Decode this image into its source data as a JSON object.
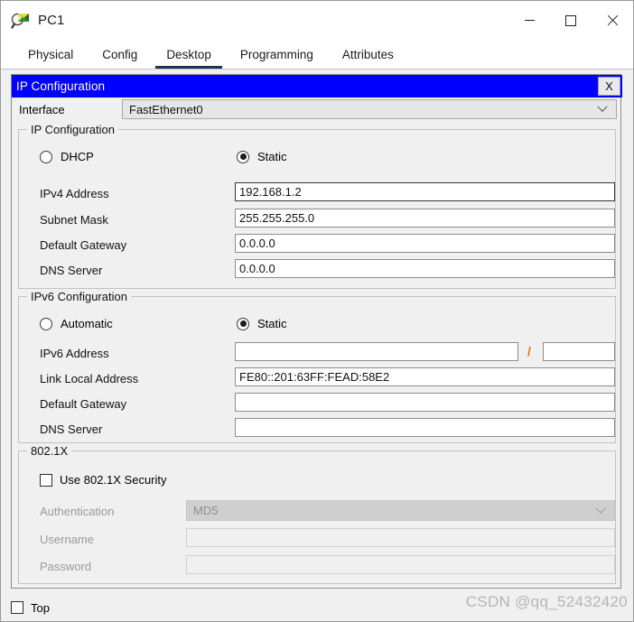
{
  "window": {
    "title": "PC1",
    "icon": "packet-tracer-inspect-icon",
    "controls": {
      "minimize": "–",
      "maximize": "□",
      "close": "✕"
    }
  },
  "tabs": [
    {
      "label": "Physical",
      "active": false
    },
    {
      "label": "Config",
      "active": false
    },
    {
      "label": "Desktop",
      "active": true
    },
    {
      "label": "Programming",
      "active": false
    },
    {
      "label": "Attributes",
      "active": false
    }
  ],
  "dialog": {
    "title": "IP Configuration",
    "close_label": "X",
    "header_color": "#0000ff",
    "interface": {
      "label": "Interface",
      "value": "FastEthernet0"
    }
  },
  "ipv4": {
    "legend": "IP Configuration",
    "mode": {
      "dhcp_label": "DHCP",
      "dhcp_selected": false,
      "static_label": "Static",
      "static_selected": true
    },
    "fields": [
      {
        "label": "IPv4 Address",
        "value": "192.168.1.2",
        "focused": true
      },
      {
        "label": "Subnet Mask",
        "value": "255.255.255.0",
        "focused": false
      },
      {
        "label": "Default Gateway",
        "value": "0.0.0.0",
        "focused": false
      },
      {
        "label": "DNS Server",
        "value": "0.0.0.0",
        "focused": false
      }
    ]
  },
  "ipv6": {
    "legend": "IPv6 Configuration",
    "mode": {
      "auto_label": "Automatic",
      "auto_selected": false,
      "static_label": "Static",
      "static_selected": true
    },
    "address": {
      "label": "IPv6 Address",
      "value": "",
      "separator": "/",
      "prefix_value": ""
    },
    "fields": [
      {
        "label": "Link Local Address",
        "value": "FE80::201:63FF:FEAD:58E2"
      },
      {
        "label": "Default Gateway",
        "value": ""
      },
      {
        "label": "DNS Server",
        "value": ""
      }
    ]
  },
  "dot1x": {
    "legend": "802.1X",
    "use_security_label": "Use 802.1X Security",
    "use_security_checked": false,
    "authentication": {
      "label": "Authentication",
      "value": "MD5",
      "disabled": true
    },
    "username": {
      "label": "Username",
      "value": "",
      "disabled": true
    },
    "password": {
      "label": "Password",
      "value": "",
      "disabled": true
    }
  },
  "footer": {
    "top_label": "Top",
    "top_checked": false,
    "watermark": "CSDN @qq_52432420"
  }
}
